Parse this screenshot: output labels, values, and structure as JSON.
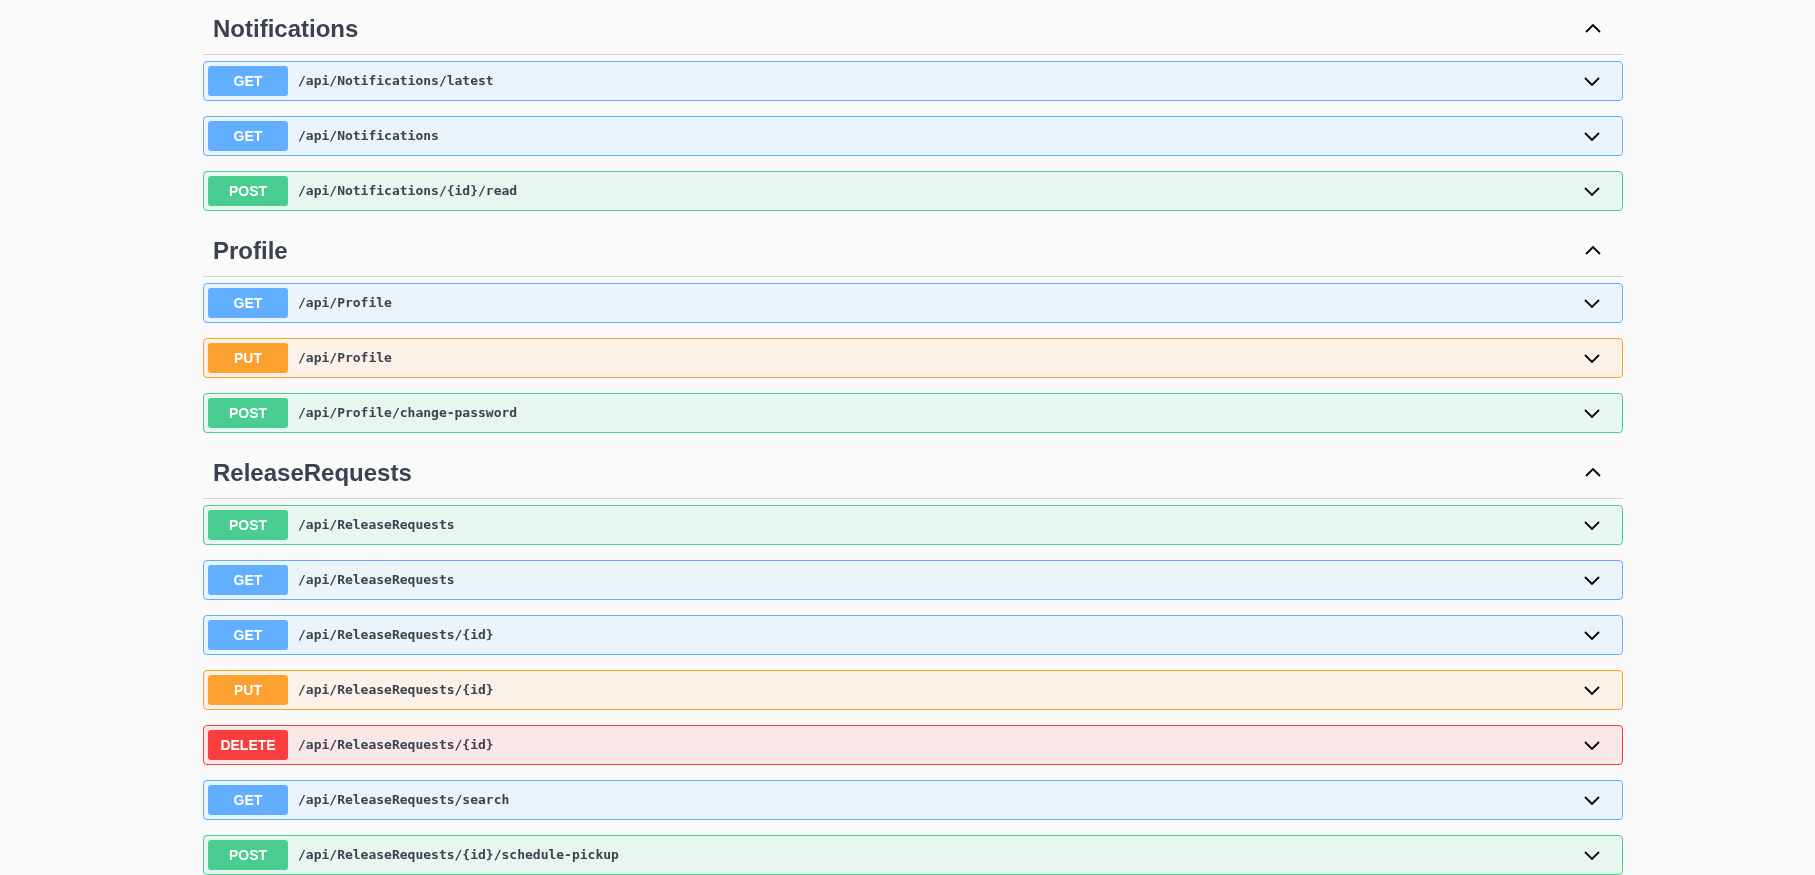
{
  "sections": [
    {
      "title": "Notifications",
      "expanded": true,
      "operations": [
        {
          "method": "GET",
          "path": "/api/Notifications/latest",
          "expanded": false
        },
        {
          "method": "GET",
          "path": "/api/Notifications",
          "expanded": false
        },
        {
          "method": "POST",
          "path": "/api/Notifications/{id}/read",
          "expanded": false
        }
      ]
    },
    {
      "title": "Profile",
      "expanded": true,
      "operations": [
        {
          "method": "GET",
          "path": "/api/Profile",
          "expanded": false
        },
        {
          "method": "PUT",
          "path": "/api/Profile",
          "expanded": false
        },
        {
          "method": "POST",
          "path": "/api/Profile/change-password",
          "expanded": false
        }
      ]
    },
    {
      "title": "ReleaseRequests",
      "expanded": true,
      "operations": [
        {
          "method": "POST",
          "path": "/api/ReleaseRequests",
          "expanded": false
        },
        {
          "method": "GET",
          "path": "/api/ReleaseRequests",
          "expanded": false
        },
        {
          "method": "GET",
          "path": "/api/ReleaseRequests/{id}",
          "expanded": false
        },
        {
          "method": "PUT",
          "path": "/api/ReleaseRequests/{id}",
          "expanded": false
        },
        {
          "method": "DELETE",
          "path": "/api/ReleaseRequests/{id}",
          "expanded": false
        },
        {
          "method": "GET",
          "path": "/api/ReleaseRequests/search",
          "expanded": false
        },
        {
          "method": "POST",
          "path": "/api/ReleaseRequests/{id}/schedule-pickup",
          "expanded": false
        }
      ]
    }
  ]
}
